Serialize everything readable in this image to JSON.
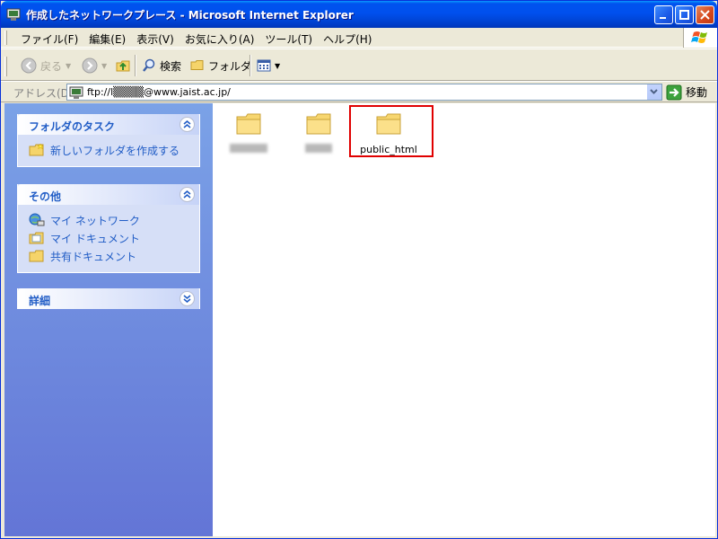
{
  "window": {
    "title": "作成したネットワークプレース - Microsoft Internet Explorer",
    "title_bar_color": "#0054E3"
  },
  "menubar": {
    "items": [
      "ファイル(F)",
      "編集(E)",
      "表示(V)",
      "お気に入り(A)",
      "ツール(T)",
      "ヘルプ(H)"
    ]
  },
  "toolbar": {
    "back_label": "戻る",
    "search_label": "検索",
    "folders_label": "フォルダ"
  },
  "address": {
    "label": "アドレス(D)",
    "value": "ftp://l▒▒▒▒@www.jaist.ac.jp/",
    "go_label": "移動"
  },
  "taskpane": {
    "panels": [
      {
        "title": "フォルダのタスク",
        "tasks": [
          {
            "label": "新しいフォルダを作成する",
            "icon": "new-folder-icon"
          }
        ]
      },
      {
        "title": "その他",
        "tasks": [
          {
            "label": "マイ ネットワーク",
            "icon": "network-icon"
          },
          {
            "label": "マイ ドキュメント",
            "icon": "documents-icon"
          },
          {
            "label": "共有ドキュメント",
            "icon": "shared-folder-icon"
          }
        ]
      },
      {
        "title": "詳細",
        "tasks": []
      }
    ],
    "link_color": "#215DC6"
  },
  "content": {
    "folders": [
      {
        "name": "",
        "blurred": true
      },
      {
        "name": "",
        "blurred": true
      },
      {
        "name": "public_html",
        "blurred": false,
        "highlighted": true
      }
    ],
    "highlight_color": "#E00000"
  }
}
